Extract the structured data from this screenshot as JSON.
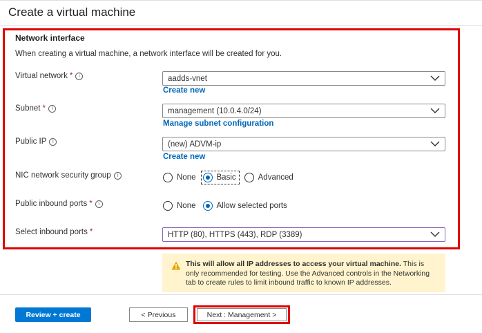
{
  "page_title": "Create a virtual machine",
  "section": {
    "heading": "Network interface",
    "description": "When creating a virtual machine, a network interface will be created for you."
  },
  "fields": {
    "virtual_network": {
      "label": "Virtual network",
      "required": "*",
      "value": "aadds-vnet",
      "link": "Create new"
    },
    "subnet": {
      "label": "Subnet",
      "required": "*",
      "value": "management (10.0.4.0/24)",
      "link": "Manage subnet configuration"
    },
    "public_ip": {
      "label": "Public IP",
      "value": "(new) ADVM-ip",
      "link": "Create new"
    },
    "nic_nsg": {
      "label": "NIC network security group",
      "options": [
        "None",
        "Basic",
        "Advanced"
      ],
      "selected": "Basic"
    },
    "public_inbound_ports": {
      "label": "Public inbound ports",
      "required": "*",
      "options": [
        "None",
        "Allow selected ports"
      ],
      "selected": "Allow selected ports"
    },
    "select_inbound_ports": {
      "label": "Select inbound ports",
      "required": "*",
      "value": "HTTP (80), HTTPS (443), RDP (3389)"
    }
  },
  "warning": {
    "bold": "This will allow all IP addresses to access your virtual machine.",
    "text": " This is only recommended for testing.  Use the Advanced controls in the Networking tab to create rules to limit inbound traffic to known IP addresses."
  },
  "footer": {
    "review_create": "Review + create",
    "previous": "< Previous",
    "next": "Next : Management >"
  },
  "icons": {
    "info": "info-icon",
    "chevron": "chevron-down-icon",
    "warning": "warning-icon"
  },
  "colors": {
    "accent": "#0078d4",
    "link": "#0067b8",
    "highlight": "#e00000",
    "warning_bg": "#fff4ce",
    "warning_icon": "#e8a200"
  }
}
